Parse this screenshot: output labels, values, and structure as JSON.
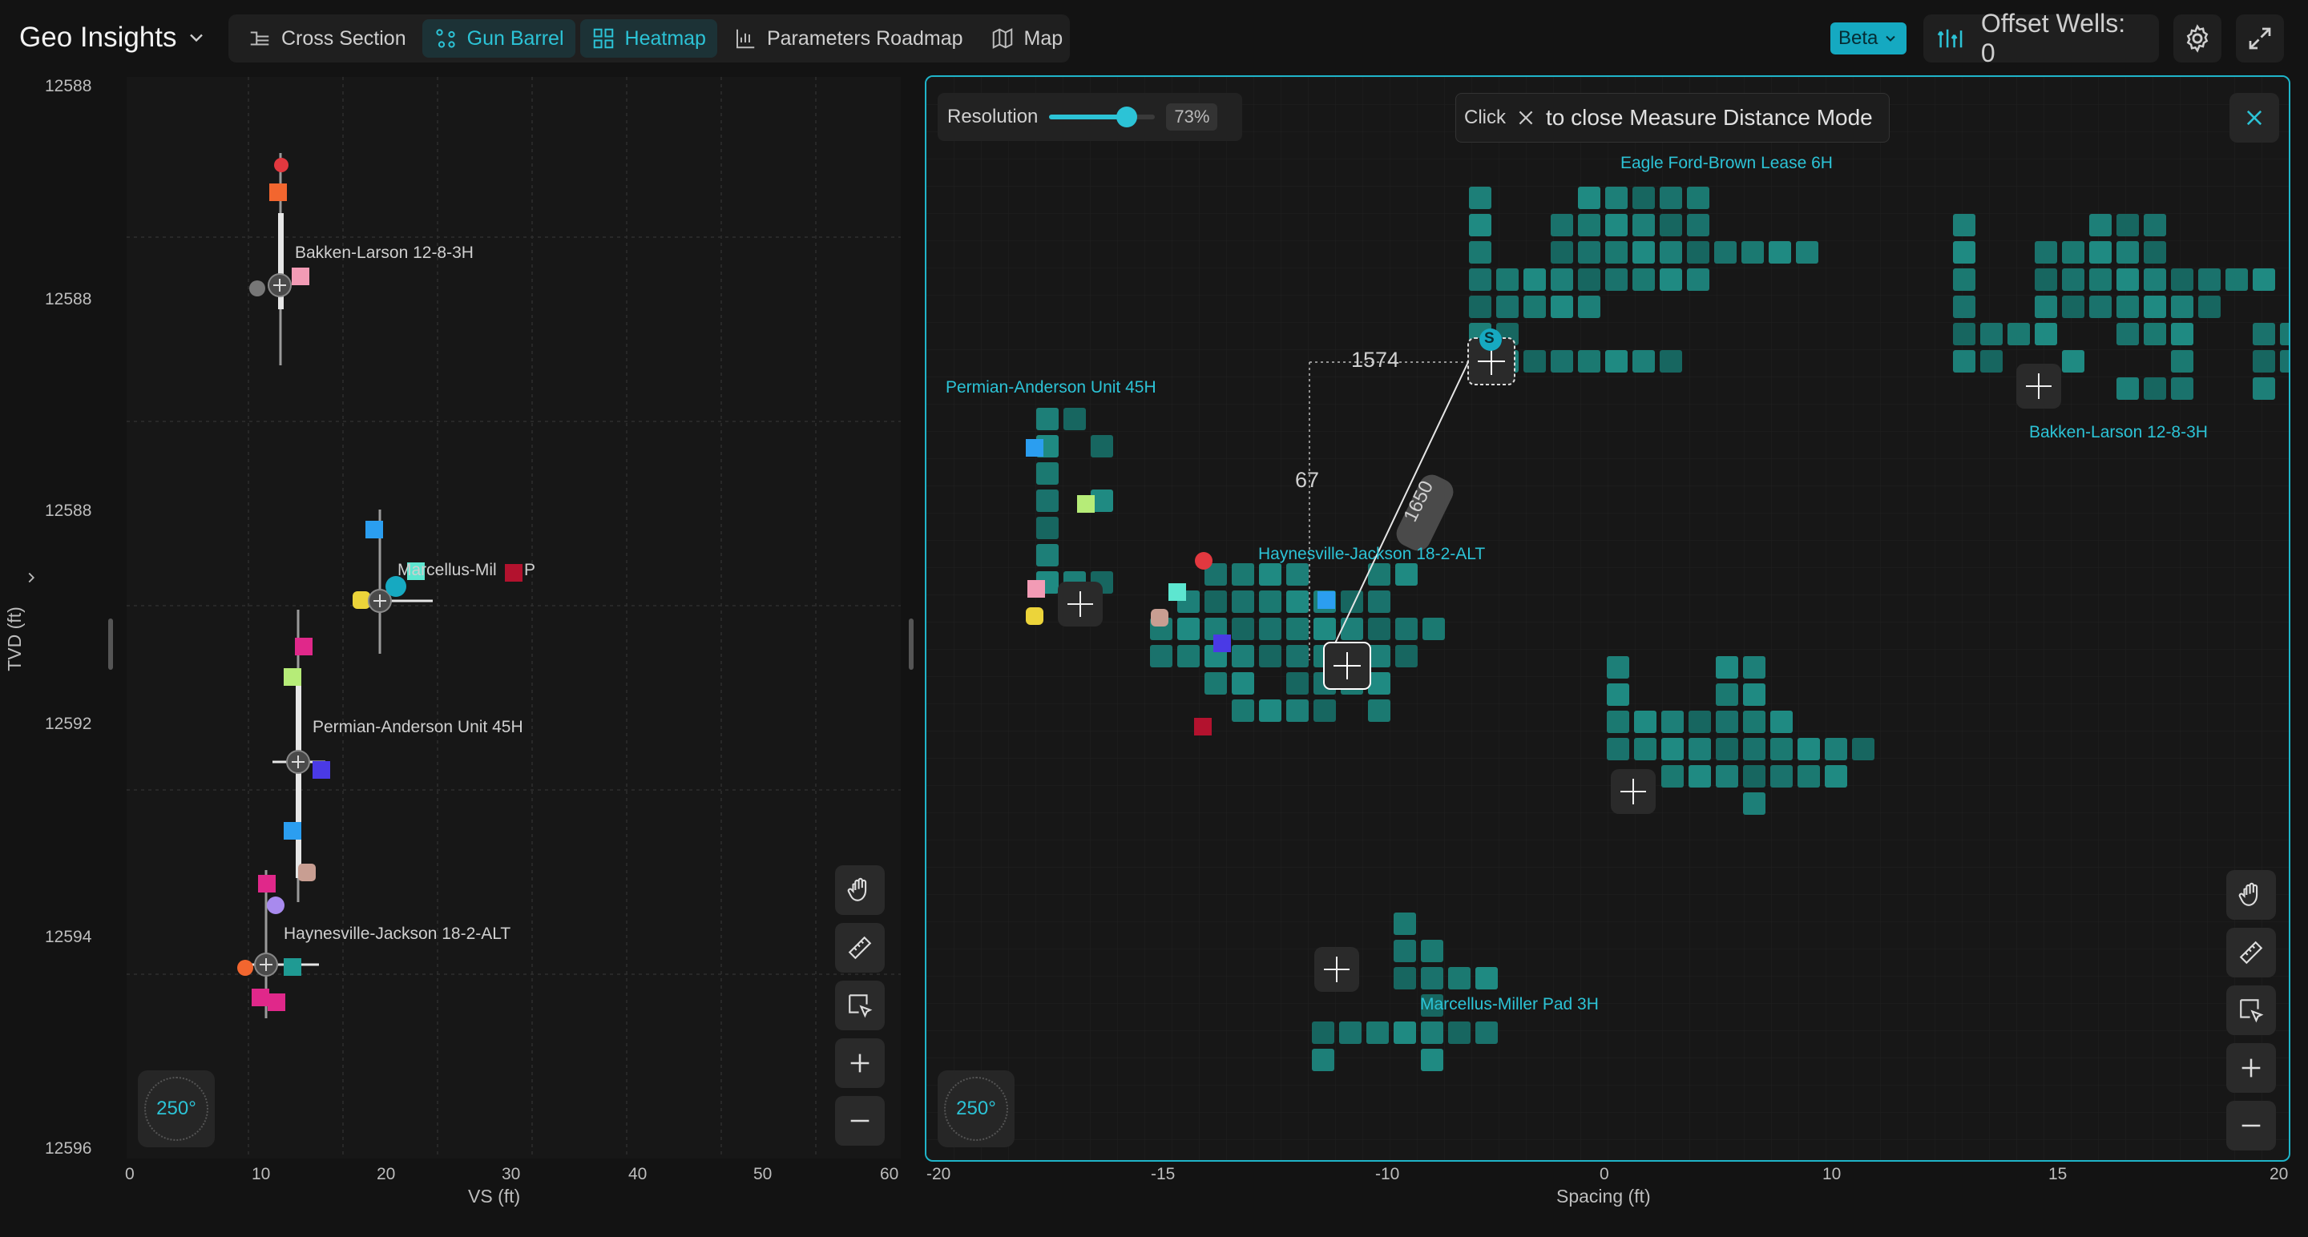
{
  "app": {
    "title": "Geo Insights"
  },
  "tabs": [
    {
      "label": "Cross Section",
      "icon": "cross-section-icon",
      "active": false
    },
    {
      "label": "Gun Barrel",
      "icon": "gun-barrel-icon",
      "active": true
    },
    {
      "label": "Heatmap",
      "icon": "heatmap-icon",
      "active": true
    },
    {
      "label": "Parameters Roadmap",
      "icon": "roadmap-icon",
      "active": false
    },
    {
      "label": "Map",
      "icon": "map-icon",
      "active": false
    }
  ],
  "header_right": {
    "beta_label": "Beta",
    "offset_wells_label": "Offset Wells: 0"
  },
  "colors": {
    "accent": "#2cc3d6",
    "teal_cell": "#1f7d76",
    "background": "#131313",
    "panel": "#171717"
  },
  "gun_barrel": {
    "y_axis_title": "TVD (ft)",
    "x_axis_title": "VS (ft)",
    "y_tick_labels": [
      "12588",
      "12588",
      "12588",
      "12592",
      "12594",
      "12596"
    ],
    "x_tick_labels": [
      "0",
      "10",
      "20",
      "30",
      "40",
      "50",
      "60"
    ],
    "well_labels": [
      "Bakken-Larson 12-8-3H",
      "Marcellus-Mil",
      "P",
      "Permian-Anderson Unit 45H",
      "Haynesville-Jackson 18-2-ALT"
    ],
    "compass_label": "250°"
  },
  "heatmap": {
    "resolution_label": "Resolution",
    "resolution_value": "73%",
    "resolution_fraction": 0.73,
    "measure_click": "Click",
    "measure_text": "to close Measure Distance Mode",
    "x_axis_title": "Spacing (ft)",
    "x_tick_labels": [
      "-20",
      "-15",
      "-10",
      "0",
      "10",
      "15",
      "20"
    ],
    "well_labels": [
      "Eagle Ford-Brown Lease 6H",
      "Permian-Anderson Unit 45H",
      "Bakken-Larson 12-8-3H",
      "Haynesville-Jackson 18-2-ALT",
      "Marcellus-Miller Pad 3H"
    ],
    "measure_labels": {
      "horizontal": "1574",
      "vertical": "67",
      "diagonal": "1650"
    },
    "badge_s": "S",
    "compass_label": "250°"
  }
}
